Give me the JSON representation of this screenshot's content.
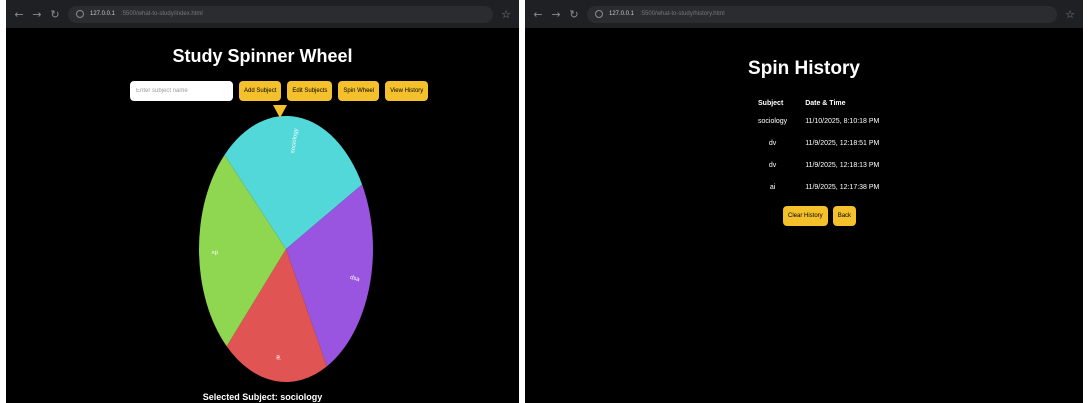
{
  "wheel_window": {
    "url_host": "127.0.0.1",
    "url_path": ":5500/what-to-study/index.html",
    "title": "Study Spinner Wheel",
    "input_placeholder": "Enter subject name",
    "buttons": {
      "add": "Add Subject",
      "edit": "Edit Subjects",
      "spin": "Spin Wheel",
      "view": "View History"
    },
    "wheel_segments": [
      {
        "label": "sociology",
        "color": "#52d8d8"
      },
      {
        "label": "dsa",
        "color": "#9a55e0"
      },
      {
        "label": "ai",
        "color": "#e05454"
      },
      {
        "label": "dv",
        "color": "#8fd651"
      }
    ],
    "selected_label": "Selected Subject:",
    "selected_value": "sociology"
  },
  "history_window": {
    "url_host": "127.0.0.1",
    "url_path": ":5500/what-to-study/history.html",
    "title": "Spin History",
    "headers": {
      "subject": "Subject",
      "datetime": "Date & Time"
    },
    "rows": [
      {
        "subject": "sociology",
        "datetime": "11/10/2025, 8:10:18 PM"
      },
      {
        "subject": "dv",
        "datetime": "11/9/2025, 12:18:51 PM"
      },
      {
        "subject": "dv",
        "datetime": "11/9/2025, 12:18:13 PM"
      },
      {
        "subject": "ai",
        "datetime": "11/9/2025, 12:17:38 PM"
      }
    ],
    "buttons": {
      "clear": "Clear History",
      "back": "Back"
    }
  },
  "colors": {
    "accent": "#f4c02b",
    "background": "#000000"
  }
}
